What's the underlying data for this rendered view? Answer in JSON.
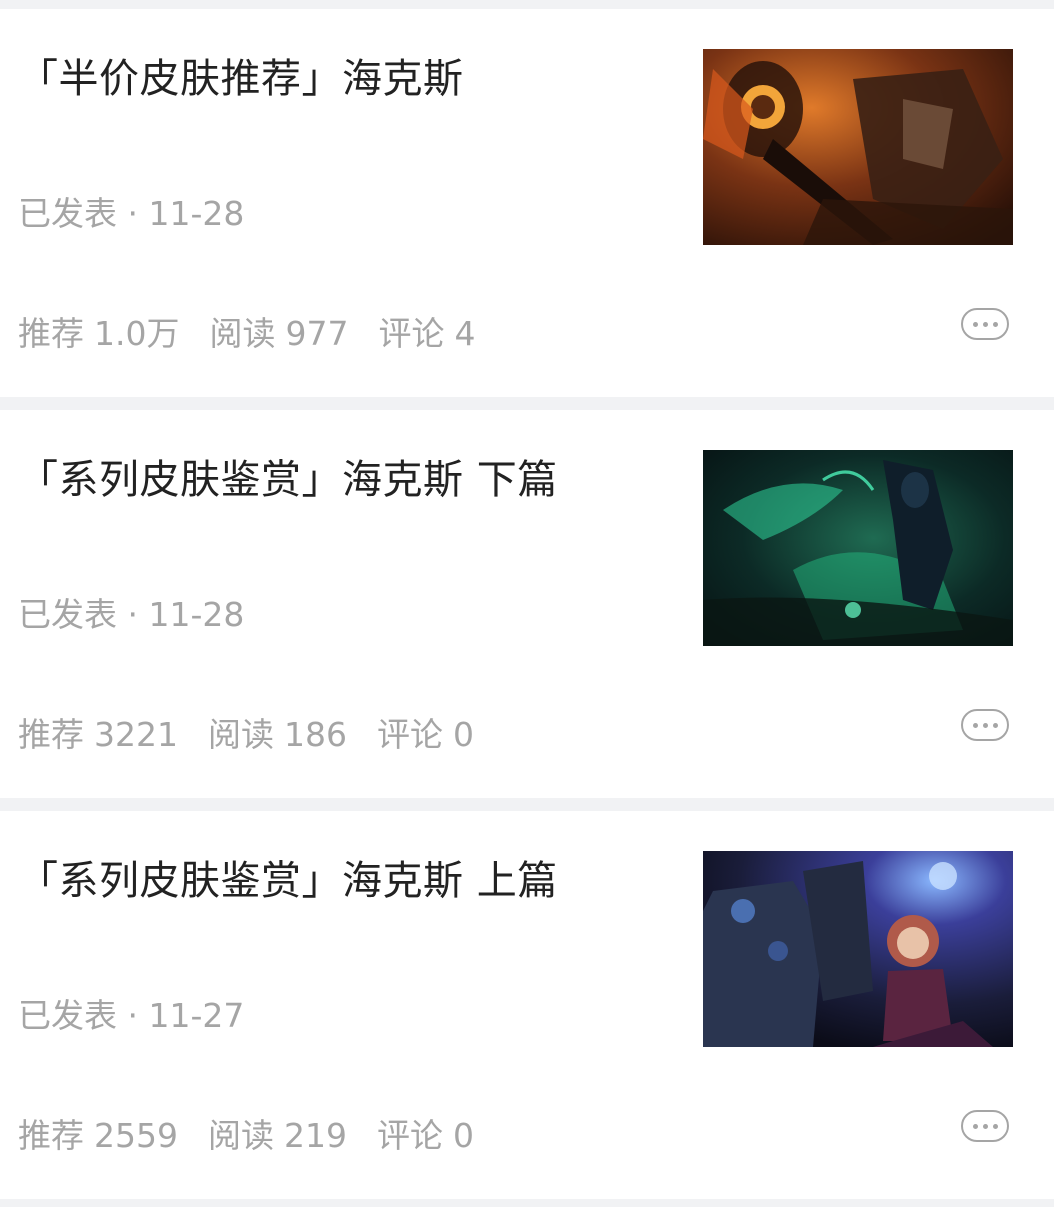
{
  "articles": [
    {
      "title": "「半价皮肤推荐」海克斯",
      "date": "已发表 · 11-28",
      "stats": {
        "recommend_label": "推荐",
        "recommend_value": "1.0万",
        "read_label": "阅读",
        "read_value": "977",
        "comment_label": "评论",
        "comment_value": "4"
      },
      "thumbnail_theme": "fiery-orange"
    },
    {
      "title": "「系列皮肤鉴赏」海克斯 下篇",
      "date": "已发表 · 11-28",
      "stats": {
        "recommend_label": "推荐",
        "recommend_value": "3221",
        "read_label": "阅读",
        "read_value": "186",
        "comment_label": "评论",
        "comment_value": "0"
      },
      "thumbnail_theme": "dark-green"
    },
    {
      "title": "「系列皮肤鉴赏」海克斯 上篇",
      "date": "已发表 · 11-27",
      "stats": {
        "recommend_label": "推荐",
        "recommend_value": "2559",
        "read_label": "阅读",
        "read_value": "219",
        "comment_label": "评论",
        "comment_value": "0"
      },
      "thumbnail_theme": "blue-purple"
    }
  ],
  "colors": {
    "page_background": "#f1f2f4",
    "card_background": "#ffffff",
    "title_text": "#222222",
    "meta_text": "#a5a5a5"
  },
  "icons": {
    "more_button": "more-dots-icon"
  }
}
